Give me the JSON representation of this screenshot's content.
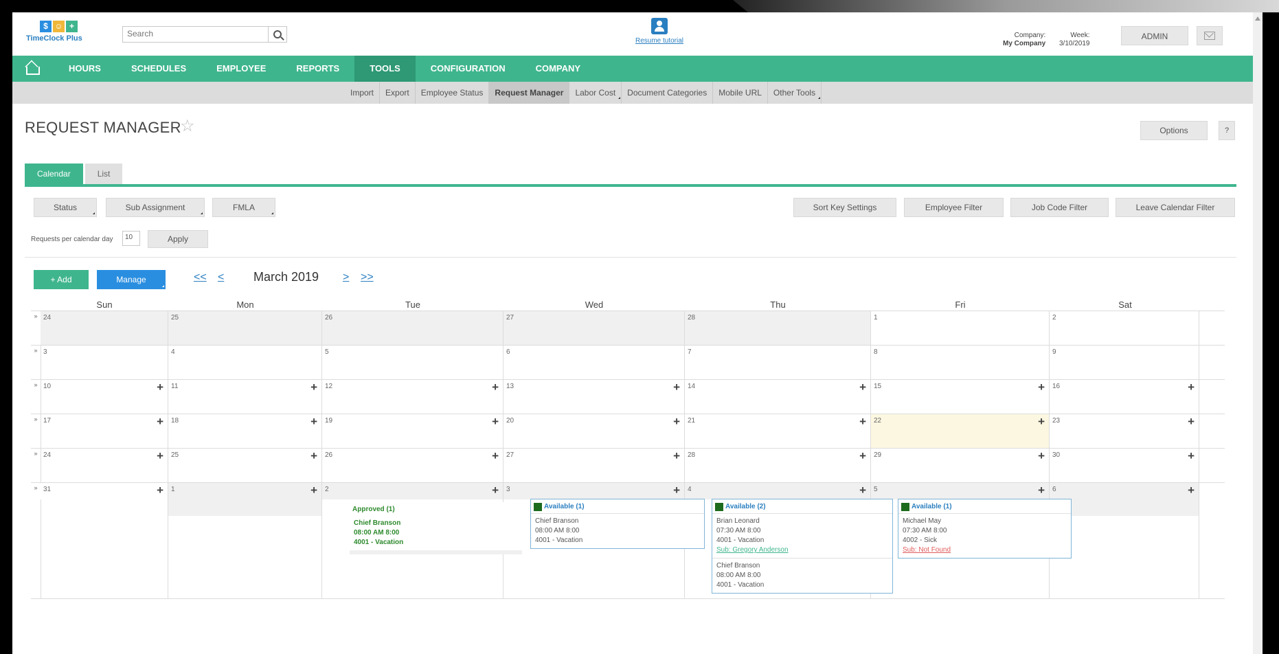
{
  "header": {
    "logo_text": "TimeClock Plus",
    "logo_icon_letters": [
      "$",
      "☺",
      "+"
    ],
    "search_placeholder": "Search",
    "tutorial_link": "Resume tutorial",
    "company_label": "Company:",
    "company_value": "My Company",
    "week_label": "Week:",
    "week_value": "3/10/2019",
    "admin_label": "ADMIN"
  },
  "nav": {
    "items": [
      "HOURS",
      "SCHEDULES",
      "EMPLOYEE",
      "REPORTS",
      "TOOLS",
      "CONFIGURATION",
      "COMPANY"
    ],
    "active": "TOOLS"
  },
  "subnav": {
    "items": [
      "Import",
      "Export",
      "Employee Status",
      "Request Manager",
      "Labor Cost",
      "Document Categories",
      "Mobile URL",
      "Other Tools"
    ],
    "active": "Request Manager"
  },
  "page": {
    "title": "REQUEST MANAGER",
    "options_label": "Options",
    "help_label": "?"
  },
  "tabs": [
    "Calendar",
    "List"
  ],
  "filters": {
    "left": [
      "Status",
      "Sub Assignment",
      "FMLA"
    ],
    "right": [
      "Sort Key Settings",
      "Employee Filter",
      "Job Code Filter",
      "Leave Calendar Filter"
    ],
    "requests_label": "Requests per calendar day",
    "requests_value": "10",
    "apply_label": "Apply"
  },
  "toolbar": {
    "add_label": "+ Add",
    "manage_label": "Manage",
    "first_label": "<<",
    "prev_label": "<",
    "month_label": "March 2019",
    "next_label": ">",
    "last_label": ">>"
  },
  "calendar": {
    "weekdays": [
      "Sun",
      "Mon",
      "Tue",
      "Wed",
      "Thu",
      "Fri",
      "Sat"
    ],
    "expander": "»",
    "weeks": [
      [
        "24",
        "25",
        "26",
        "27",
        "28",
        "1",
        "2"
      ],
      [
        "3",
        "4",
        "5",
        "6",
        "7",
        "8",
        "9"
      ],
      [
        "10",
        "11",
        "12",
        "13",
        "14",
        "15",
        "16"
      ],
      [
        "17",
        "18",
        "19",
        "20",
        "21",
        "22",
        "23"
      ],
      [
        "24",
        "25",
        "26",
        "27",
        "28",
        "29",
        "30"
      ],
      [
        "31",
        "1",
        "2",
        "3",
        "4",
        "5",
        "6"
      ]
    ],
    "today": "22"
  },
  "requests": {
    "tue": {
      "header": "Approved (1)",
      "entries": [
        {
          "name": "Chief Branson",
          "time": "08:00 AM 8:00",
          "code": "4001 - Vacation"
        }
      ]
    },
    "wed": {
      "header": "Available (1)",
      "entries": [
        {
          "name": "Chief Branson",
          "time": "08:00 AM 8:00",
          "code": "4001 - Vacation"
        }
      ]
    },
    "thu": {
      "header": "Available (2)",
      "entries": [
        {
          "name": "Brian Leonard",
          "time": "07:30 AM 8:00",
          "code": "4001 - Vacation",
          "sub": "Sub: Gregory Anderson"
        },
        {
          "name": "Chief Branson",
          "time": "08:00 AM 8:00",
          "code": "4001 - Vacation"
        }
      ]
    },
    "fri": {
      "header": "Available (1)",
      "entries": [
        {
          "name": "Michael May",
          "time": "07:30 AM 8:00",
          "code": "4002 - Sick",
          "sub": "Sub: Not Found"
        }
      ]
    }
  },
  "colors": {
    "brand_green": "#3fb58e",
    "active_green": "#2e9974",
    "brand_blue": "#2a7fc0",
    "manage_blue": "#2a8ee0",
    "today_yellow": "#fcf7e1"
  }
}
